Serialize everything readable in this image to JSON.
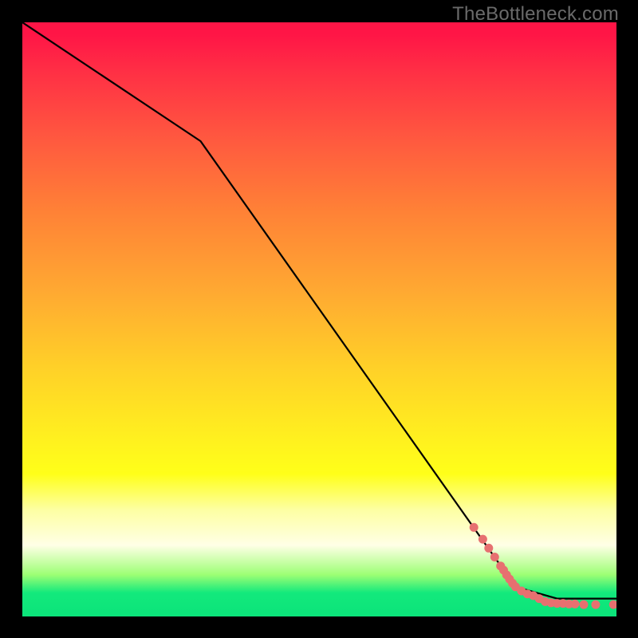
{
  "watermark": "TheBottleneck.com",
  "chart_data": {
    "type": "line",
    "title": "",
    "xlabel": "",
    "ylabel": "",
    "xlim": [
      0,
      100
    ],
    "ylim": [
      0,
      100
    ],
    "grid": false,
    "gradient_fill": {
      "direction": "vertical",
      "stops": [
        {
          "at": 0.0,
          "color": "#ff1546"
        },
        {
          "at": 0.2,
          "color": "#ff5a3f"
        },
        {
          "at": 0.45,
          "color": "#ffa832"
        },
        {
          "at": 0.7,
          "color": "#fff01f"
        },
        {
          "at": 0.88,
          "color": "#ffffe6"
        },
        {
          "at": 0.96,
          "color": "#13e97c"
        },
        {
          "at": 1.0,
          "color": "#0be37a"
        }
      ]
    },
    "curve": {
      "comment": "Black trajectory: piecewise linear. First a shallow descent, knee near x≈30, then a steeper straight drop to near-bottom at x≈83, then flattening along y≈3 toward x=100. x and y are in percent of the plot area (0 at left/bottom).",
      "points": [
        {
          "x": 0,
          "y": 100
        },
        {
          "x": 30,
          "y": 80
        },
        {
          "x": 83,
          "y": 5
        },
        {
          "x": 90,
          "y": 3
        },
        {
          "x": 100,
          "y": 3
        }
      ]
    },
    "scatter": {
      "color": "#e77070",
      "radius": 5,
      "points": [
        {
          "x": 76,
          "y": 15
        },
        {
          "x": 77.5,
          "y": 13
        },
        {
          "x": 78.5,
          "y": 11.5
        },
        {
          "x": 79.5,
          "y": 10
        },
        {
          "x": 80.5,
          "y": 8.5
        },
        {
          "x": 81,
          "y": 7.8
        },
        {
          "x": 81.5,
          "y": 7
        },
        {
          "x": 82,
          "y": 6.3
        },
        {
          "x": 82.5,
          "y": 5.6
        },
        {
          "x": 83,
          "y": 5
        },
        {
          "x": 84,
          "y": 4.3
        },
        {
          "x": 85,
          "y": 3.8
        },
        {
          "x": 86,
          "y": 3.5
        },
        {
          "x": 87,
          "y": 3.0
        },
        {
          "x": 88,
          "y": 2.5
        },
        {
          "x": 89,
          "y": 2.3
        },
        {
          "x": 90,
          "y": 2.2
        },
        {
          "x": 91,
          "y": 2.2
        },
        {
          "x": 92,
          "y": 2.1
        },
        {
          "x": 93,
          "y": 2.1
        },
        {
          "x": 94.5,
          "y": 2.0
        },
        {
          "x": 96.5,
          "y": 2.0
        },
        {
          "x": 99.5,
          "y": 2.0
        }
      ]
    }
  }
}
